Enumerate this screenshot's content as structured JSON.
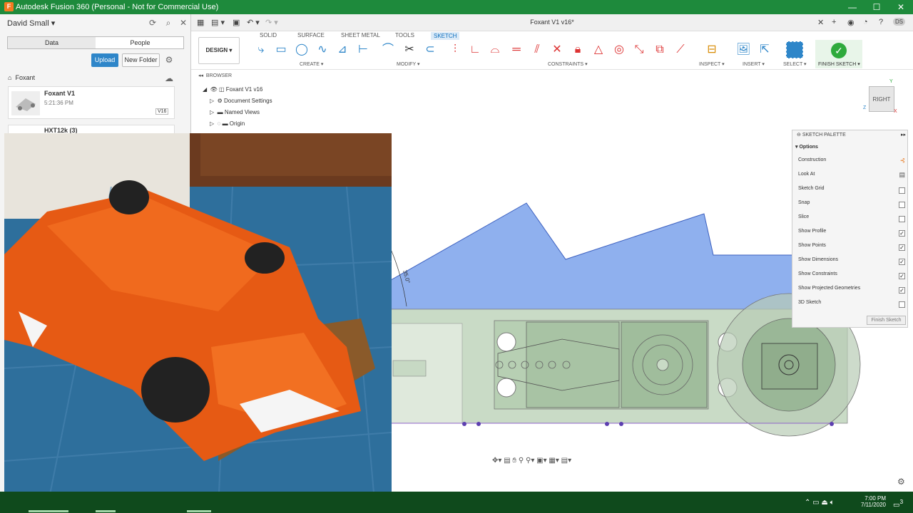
{
  "app": {
    "title": "Autodesk Fusion 360 (Personal - Not for Commercial Use)",
    "icon_letter": "F",
    "window_buttons": [
      "—",
      "☐",
      "✕"
    ]
  },
  "data_panel": {
    "user": "David Small",
    "tabs": [
      "Data",
      "People"
    ],
    "upload_label": "Upload",
    "new_folder_label": "New Folder",
    "breadcrumb": "Foxant",
    "items": [
      {
        "name": "Foxant V1",
        "time": "5:21:36 PM",
        "version": "V16"
      },
      {
        "name": "HXT12k (3)"
      }
    ]
  },
  "doc": {
    "title": "Foxant V1 v16*"
  },
  "workspace_tabs": [
    "SOLID",
    "SURFACE",
    "SHEET METAL",
    "TOOLS",
    "SKETCH"
  ],
  "design_button": "DESIGN",
  "groups": [
    "CREATE",
    "MODIFY",
    "CONSTRAINTS",
    "INSPECT",
    "INSERT",
    "SELECT",
    "FINISH SKETCH"
  ],
  "browser": {
    "header": "BROWSER",
    "items": [
      "Foxant V1 v16",
      "Document Settings",
      "Named Views",
      "Origin"
    ]
  },
  "viewcube": {
    "label": "RIGHT",
    "axis_y": "Y",
    "axis_z": "Z",
    "axis_x": "X"
  },
  "dimension_label": "35.0°",
  "sketch_palette": {
    "header": "SKETCH PALETTE",
    "section": "Options",
    "rows": [
      {
        "label": "Construction",
        "state": "icon"
      },
      {
        "label": "Look At",
        "state": "icon"
      },
      {
        "label": "Sketch Grid",
        "state": "off"
      },
      {
        "label": "Snap",
        "state": "off"
      },
      {
        "label": "Slice",
        "state": "off"
      },
      {
        "label": "Show Profile",
        "state": "on"
      },
      {
        "label": "Show Points",
        "state": "on"
      },
      {
        "label": "Show Dimensions",
        "state": "on"
      },
      {
        "label": "Show Constraints",
        "state": "on"
      },
      {
        "label": "Show Projected Geometries",
        "state": "on"
      },
      {
        "label": "3D Sketch",
        "state": "off"
      }
    ],
    "finish_label": "Finish Sketch"
  },
  "taskbar": {
    "time": "7:00 PM",
    "date": "7/11/2020",
    "notification_count": "3"
  },
  "colors": {
    "titlebar": "#1e8a3c",
    "accent": "#2e86c9",
    "profile_fill": "#8fb0ee",
    "sketch_green": "#b7cfb3",
    "taskbar": "#0f4a1c"
  }
}
